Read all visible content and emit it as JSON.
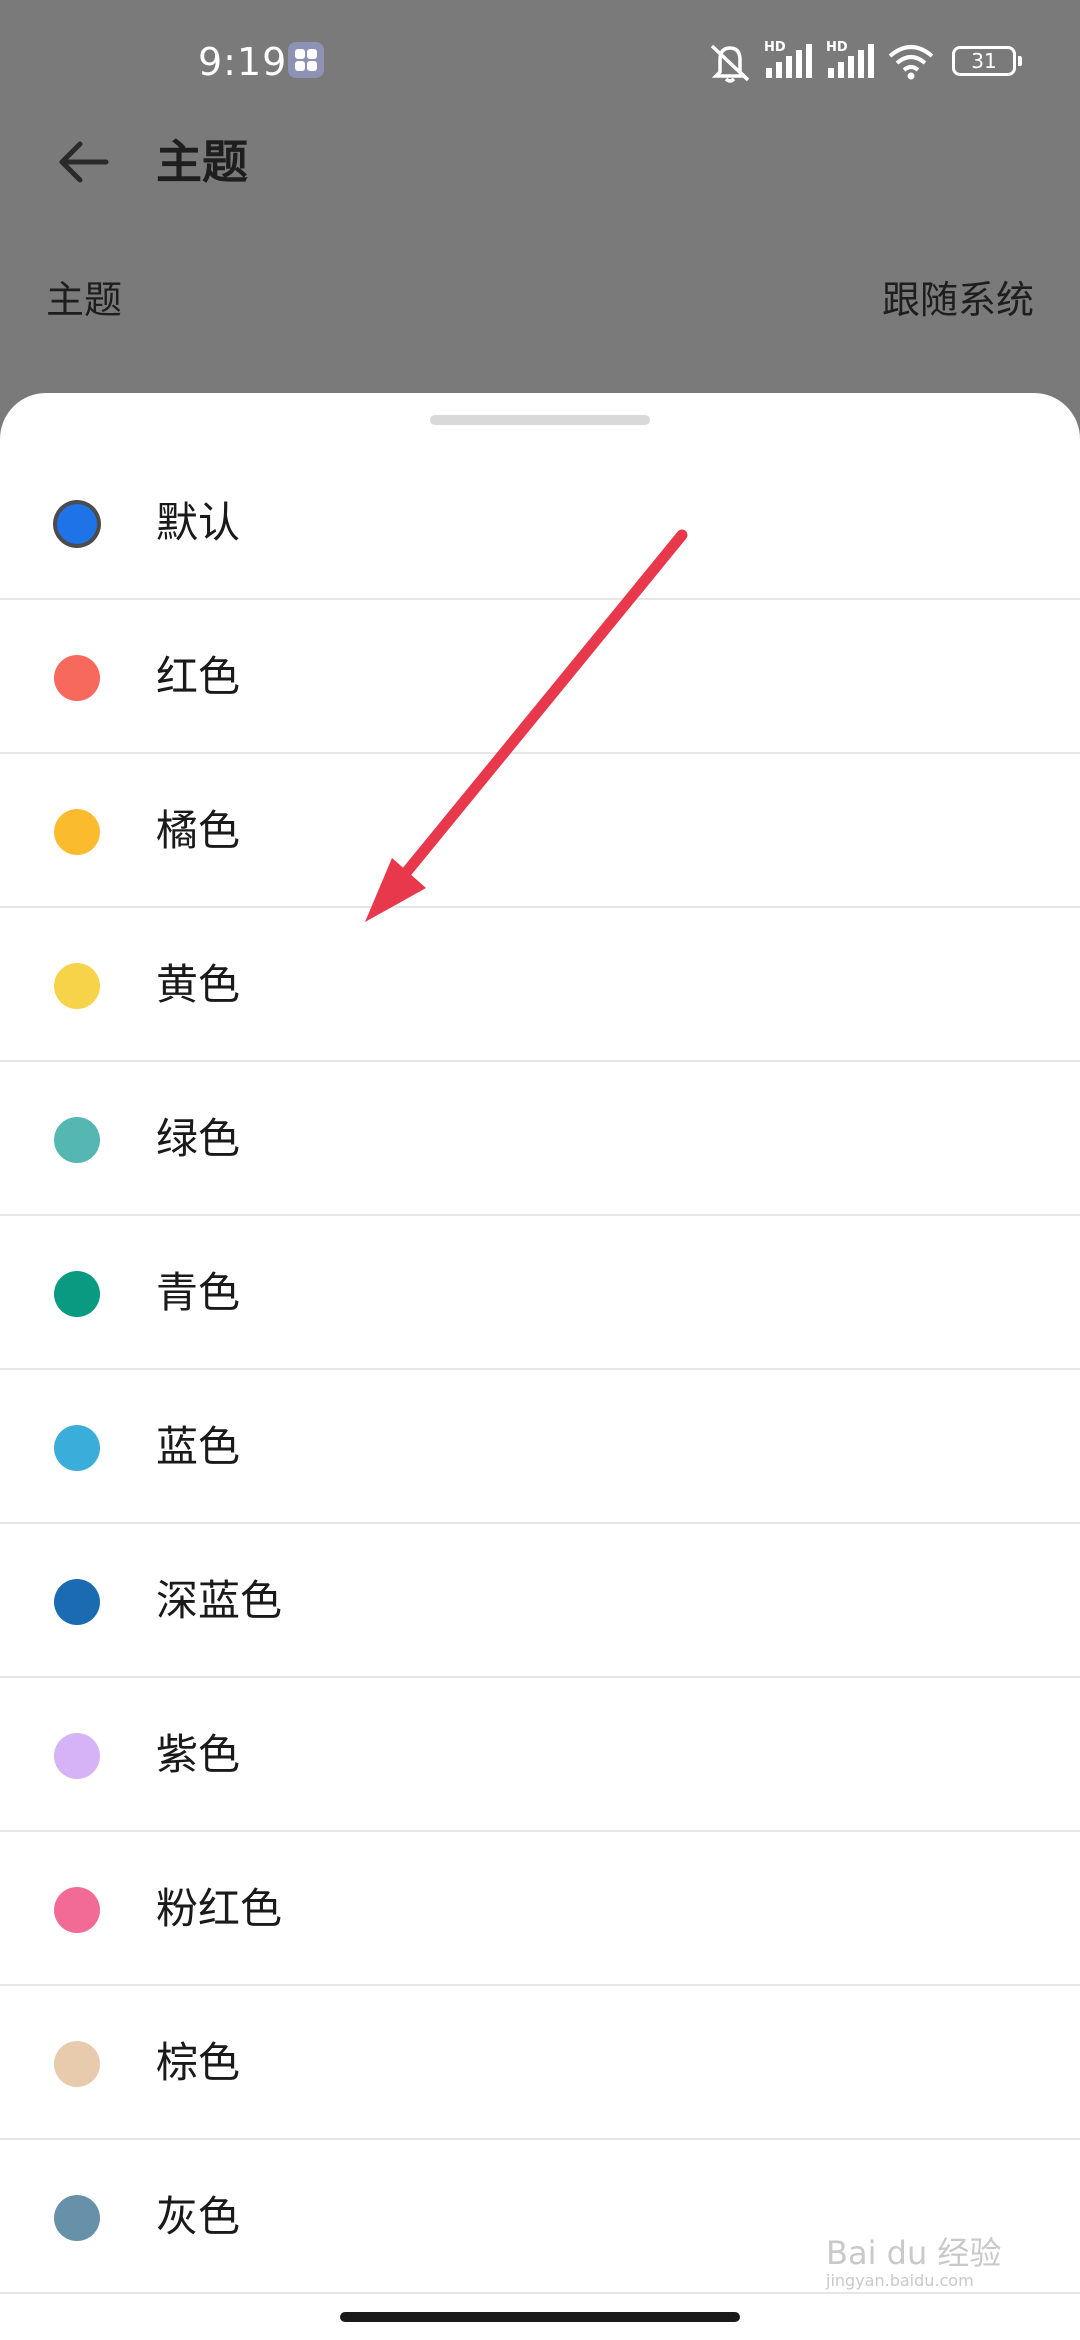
{
  "status_bar": {
    "time": "9:19",
    "battery": "31",
    "icons": [
      "app-badge-icon",
      "mute-bell-icon",
      "hd-signal-icon",
      "hd-signal-icon",
      "wifi-icon",
      "battery-icon"
    ]
  },
  "header": {
    "title": "主题",
    "back_icon": "arrow-left-icon"
  },
  "setting_row": {
    "label": "主题",
    "value": "跟随系统"
  },
  "theme_options": [
    {
      "label": "默认",
      "color": "#1e73e8",
      "selected": true
    },
    {
      "label": "红色",
      "color": "#f7695c"
    },
    {
      "label": "橘色",
      "color": "#fbbb2f"
    },
    {
      "label": "黄色",
      "color": "#f7d34a"
    },
    {
      "label": "绿色",
      "color": "#55b7b1"
    },
    {
      "label": "青色",
      "color": "#0a9a82"
    },
    {
      "label": "蓝色",
      "color": "#3aaddb"
    },
    {
      "label": "深蓝色",
      "color": "#1b6bb3"
    },
    {
      "label": "紫色",
      "color": "#d6b3f7"
    },
    {
      "label": "粉红色",
      "color": "#f16b96"
    },
    {
      "label": "棕色",
      "color": "#e8cbac"
    },
    {
      "label": "灰色",
      "color": "#6791a8"
    }
  ],
  "annotation": {
    "color": "#e8384b"
  },
  "watermark": {
    "text": "Bai du 经验",
    "subtext": "jingyan.baidu.com"
  }
}
